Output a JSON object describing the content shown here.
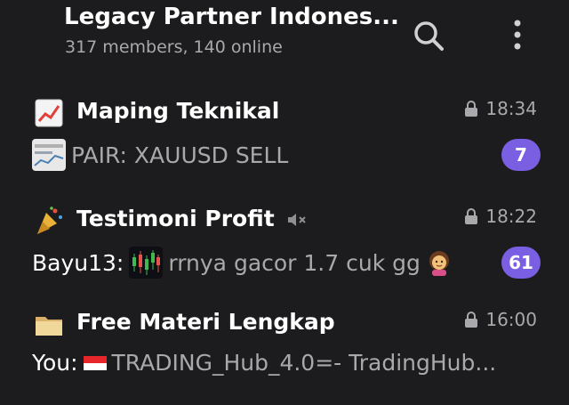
{
  "header": {
    "title": "Legacy Partner Indones...",
    "subtitle": "317 members, 140 online",
    "search_icon": "search-icon",
    "more_icon": "more-vertical-icon"
  },
  "colors": {
    "background": "#1c1c1e",
    "badge": "#7b5fe3",
    "secondary_text": "#a9a9ad"
  },
  "topics": [
    {
      "name": "Maping Teknikal",
      "icon": "chart-icon",
      "locked": true,
      "time": "18:34",
      "sender": "",
      "message": "PAIR: XAUUSD SELL",
      "has_thumbnail": true,
      "unread": "7"
    },
    {
      "name": "Testimoni Profit",
      "icon": "party-popper-icon",
      "muted": true,
      "locked": true,
      "time": "18:22",
      "sender": "Bayu13:",
      "message": "rrnya gacor 1.7 cuk gg",
      "has_thumbnail": true,
      "emoji": "woman-gesturing-ok-emoji",
      "unread": "61"
    },
    {
      "name": "Free Materi Lengkap",
      "icon": "folder-icon",
      "locked": true,
      "time": "16:00",
      "sender": "You:",
      "flag": "indonesia-flag-icon",
      "message": "TRADING_Hub_4.0=- TradingHub..."
    }
  ]
}
